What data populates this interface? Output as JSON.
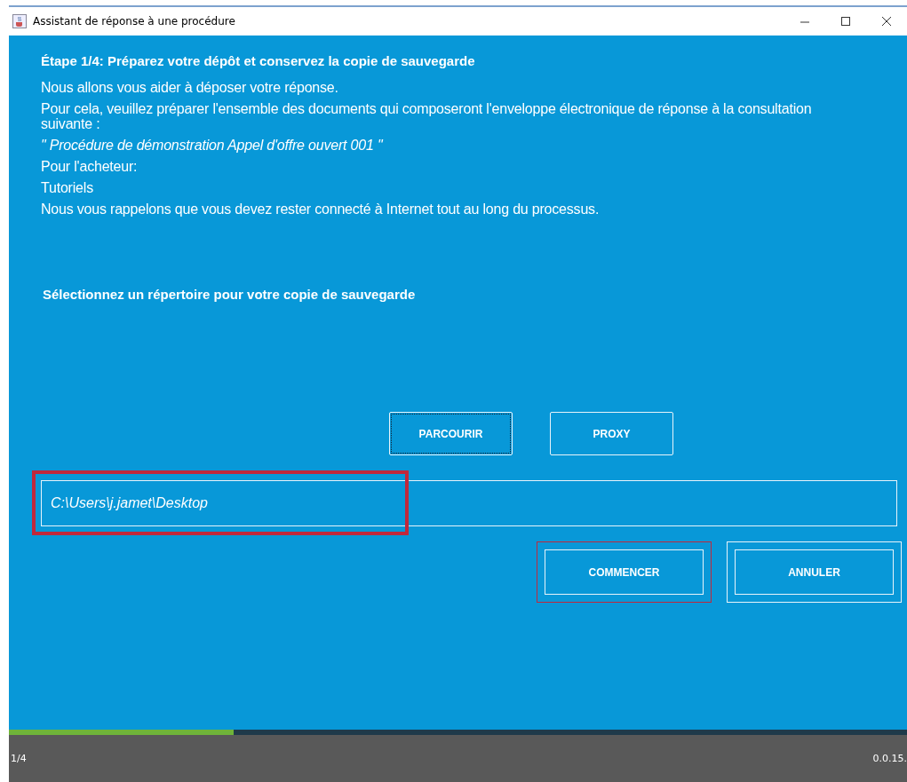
{
  "window": {
    "title": "Assistant de réponse à une procédure"
  },
  "step_title": "Étape 1/4: Préparez votre dépôt et conservez la copie de sauvegarde",
  "paragraphs": [
    {
      "text": "Nous allons vous aider à déposer votre réponse.",
      "kind": "plain"
    },
    {
      "text": "Pour cela, veuillez préparer l'ensemble des documents qui composeront l'enveloppe électronique de réponse à la consultation suivante :",
      "kind": "plain"
    },
    {
      "text": "\" Procédure de démonstration Appel d'offre ouvert 001 \"",
      "kind": "quote"
    },
    {
      "text": "Pour l'acheteur:",
      "kind": "plain"
    },
    {
      "text": "Tutoriels",
      "kind": "plain"
    },
    {
      "text": "Nous vous rappelons que vous devez rester connecté à Internet tout au long du processus.",
      "kind": "plain"
    }
  ],
  "section_title": "Sélectionnez un répertoire pour votre copie de sauvegarde",
  "browse_buttons": [
    {
      "label": "PARCOURIR",
      "focused": true
    },
    {
      "label": "PROXY",
      "focused": false
    }
  ],
  "path_field": {
    "value": "C:\\Users\\j.jamet\\Desktop",
    "highlighted": true
  },
  "action_buttons": [
    {
      "label": "COMMENCER",
      "highlighted": true
    },
    {
      "label": "ANNULER",
      "highlighted": false
    }
  ],
  "progress": {
    "level": 0.25
  },
  "status_bar": {
    "step": "1/4",
    "version": "0.0.15."
  }
}
